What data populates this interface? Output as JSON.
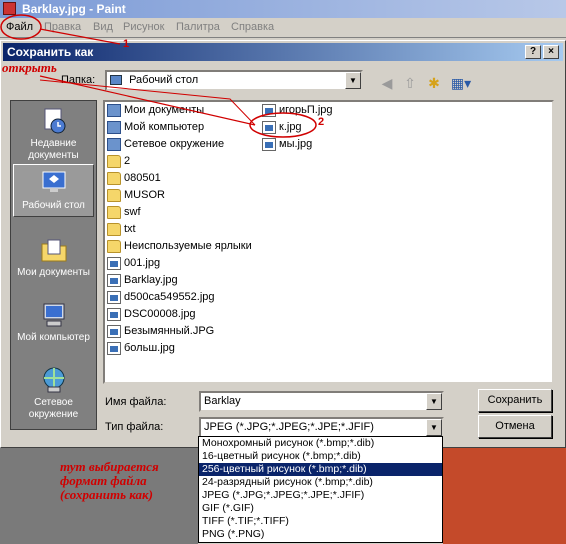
{
  "paint": {
    "title": "Barklay.jpg - Paint",
    "menu": [
      "Файл",
      "Правка",
      "Вид",
      "Рисунок",
      "Палитра",
      "Справка"
    ]
  },
  "dialog": {
    "title": "Сохранить как",
    "help_btn": "?",
    "close_btn": "×",
    "folder_label": "Папка:",
    "folder_value": "Рабочий стол",
    "places": [
      "Недавние документы",
      "Рабочий стол",
      "Мои документы",
      "Мой компьютер",
      "Сетевое окружение"
    ],
    "files_col1": [
      {
        "name": "Мои документы",
        "icon": "docs-icon"
      },
      {
        "name": "Мой компьютер",
        "icon": "computer-icon"
      },
      {
        "name": "Сетевое окружение",
        "icon": "network-icon"
      },
      {
        "name": "2",
        "icon": "folder-icon"
      },
      {
        "name": "080501",
        "icon": "folder-icon"
      },
      {
        "name": "MUSOR",
        "icon": "folder-icon"
      },
      {
        "name": "swf",
        "icon": "folder-icon"
      },
      {
        "name": "txt",
        "icon": "folder-icon"
      },
      {
        "name": "Неиспользуемые ярлыки",
        "icon": "folder-icon"
      },
      {
        "name": "001.jpg",
        "icon": "image-file-icon"
      },
      {
        "name": "Barklay.jpg",
        "icon": "image-file-icon"
      },
      {
        "name": "d500ca549552.jpg",
        "icon": "image-file-icon"
      },
      {
        "name": "DSC00008.jpg",
        "icon": "image-file-icon"
      },
      {
        "name": "Безымянный.JPG",
        "icon": "image-file-icon"
      },
      {
        "name": "больш.jpg",
        "icon": "image-file-icon"
      }
    ],
    "files_col2": [
      {
        "name": "игорьП.jpg",
        "icon": "image-file-icon"
      },
      {
        "name": "к.jpg",
        "icon": "image-file-icon"
      },
      {
        "name": "мы.jpg",
        "icon": "image-file-icon"
      }
    ],
    "filename_label": "Имя файла:",
    "filename_value": "Barklay",
    "filetype_label": "Тип файла:",
    "filetype_value": "JPEG (*.JPG;*.JPEG;*.JPE;*.JFIF)",
    "save_btn": "Сохранить",
    "cancel_btn": "Отмена",
    "filetype_options": [
      "Монохромный рисунок (*.bmp;*.dib)",
      "16-цветный рисунок (*.bmp;*.dib)",
      "256-цветный рисунок (*.bmp;*.dib)",
      "24-разрядный рисунок (*.bmp;*.dib)",
      "JPEG (*.JPG;*.JPEG;*.JPE;*.JFIF)",
      "GIF (*.GIF)",
      "TIFF (*.TIF;*.TIFF)",
      "PNG (*.PNG)"
    ],
    "highlighted_option_index": 2
  },
  "annotations": {
    "open_label": "открыть",
    "num1": "1",
    "num2": "2",
    "note_line1": "тут выбирается",
    "note_line2": "формат файла",
    "note_line3": "(сохранить как)"
  },
  "colors": {
    "annotation": "#d00000",
    "highlight": "#0a246a"
  }
}
